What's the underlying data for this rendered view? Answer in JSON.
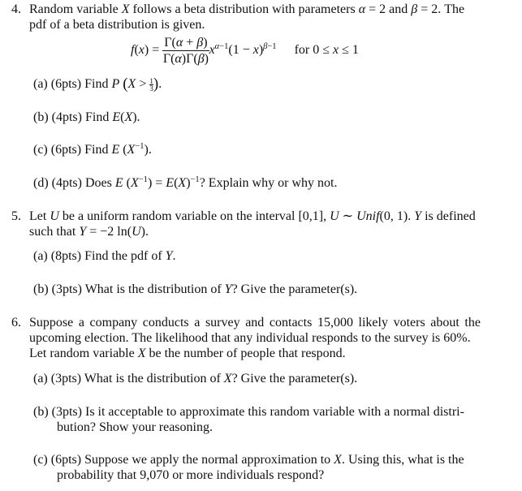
{
  "problems": [
    {
      "number": "4.",
      "statement_line1": "Random variable X follows a beta distribution with parameters α = 2 and β = 2. The",
      "statement_line2": "pdf of a beta distribution is given.",
      "params": {
        "alpha": "2",
        "beta": "2"
      },
      "formula": {
        "lhs": "f(x) =",
        "numerator": "Γ(α + β)",
        "denominator": "Γ(α)Γ(β)",
        "tail": "x^(α−1)(1 − x)^(β−1)",
        "domain": "for 0 ≤ x ≤ 1"
      },
      "parts": [
        {
          "label": "(a)",
          "points": "(6pts)",
          "text": "Find P (X > 1/3)."
        },
        {
          "label": "(b)",
          "points": "(4pts)",
          "text": "Find E(X)."
        },
        {
          "label": "(c)",
          "points": "(6pts)",
          "text": "Find E (X⁻¹)."
        },
        {
          "label": "(d)",
          "points": "(4pts)",
          "text": "Does E (X⁻¹) = E(X)⁻¹? Explain why or why not."
        }
      ]
    },
    {
      "number": "5.",
      "statement_line1": "Let U be a uniform random variable on the interval [0,1], U ∼ Unif(0, 1). Y is defined",
      "statement_line2": "such that Y = −2 ln(U).",
      "parts": [
        {
          "label": "(a)",
          "points": "(8pts)",
          "text": "Find the pdf of Y."
        },
        {
          "label": "(b)",
          "points": "(3pts)",
          "text": "What is the distribution of Y? Give the parameter(s)."
        }
      ]
    },
    {
      "number": "6.",
      "statement_line1": "Suppose a company conducts a survey and contacts 15,000 likely voters about the",
      "statement_line2": "upcoming election. The likelihood that any individual responds to the survey is 60%.",
      "statement_line3": "Let random variable X be the number of people that respond.",
      "values": {
        "voters": "15,000",
        "response_rate": "60%",
        "threshold": "9,070"
      },
      "parts": [
        {
          "label": "(a)",
          "points": "(3pts)",
          "text": "What is the distribution of X? Give the parameter(s)."
        },
        {
          "label": "(b)",
          "points": "(3pts)",
          "text_line1": "Is it acceptable to approximate this random variable with a normal distri-",
          "text_line2": "bution? Show your reasoning."
        },
        {
          "label": "(c)",
          "points": "(6pts)",
          "text_line1": "Suppose we apply the normal approximation to X. Using this, what is the",
          "text_line2": "probability that 9,070 or more individuals respond?"
        }
      ]
    }
  ]
}
